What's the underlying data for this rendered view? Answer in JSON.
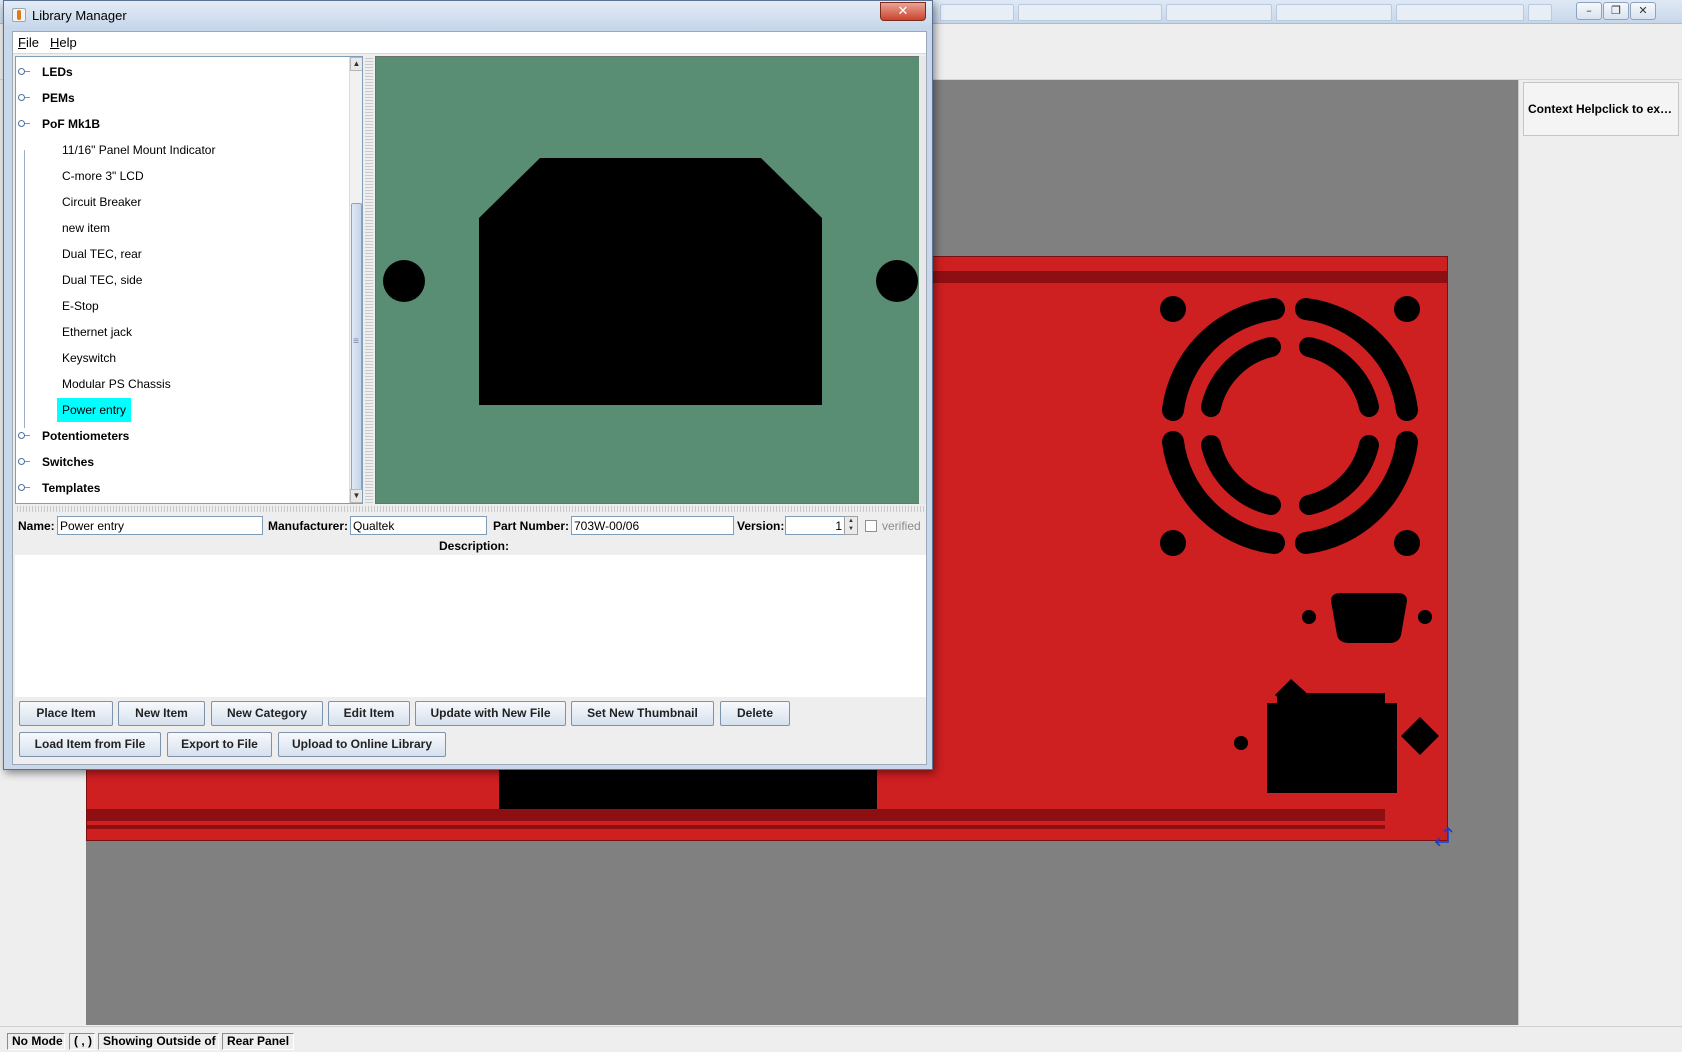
{
  "dialog": {
    "title": "Library Manager",
    "close_glyph": "✕",
    "menu": [
      "File",
      "Help"
    ]
  },
  "tree": {
    "categories_top": [
      "LEDs",
      "PEMs",
      "PoF Mk1B"
    ],
    "items": [
      "11/16\" Panel Mount Indicator",
      "C-more 3\" LCD",
      "Circuit Breaker",
      "new item",
      "Dual TEC, rear",
      "Dual TEC, side",
      "E-Stop",
      "Ethernet jack",
      "Keyswitch",
      "Modular PS Chassis",
      "Power entry"
    ],
    "selected_item": "Power entry",
    "categories_bottom": [
      "Potentiometers",
      "Switches",
      "Templates"
    ]
  },
  "fields": {
    "name_label": "Name:",
    "name_value": "Power entry",
    "manufacturer_label": "Manufacturer:",
    "manufacturer_value": "Qualtek",
    "part_number_label": "Part Number:",
    "part_number_value": "703W-00/06",
    "version_label": "Version:",
    "version_value": "1",
    "verified_label": "verified",
    "description_label": "Description:",
    "description_value": ""
  },
  "buttons_row1": [
    "Place Item",
    "New Item",
    "New Category",
    "Edit Item",
    "Update with New File",
    "Set New Thumbnail",
    "Delete"
  ],
  "buttons_row2": [
    "Load Item from File",
    "Export to File",
    "Upload to Online Library"
  ],
  "context_help": "Context Helpclick to expa...",
  "status": [
    "No Mode",
    "( , )",
    "Showing Outside of",
    "Rear Panel"
  ],
  "colors": {
    "panel_red": "#ce1f21",
    "preview_green": "#5a8e74",
    "selection_cyan": "#00ffff",
    "canvas_gray": "#808080"
  },
  "icons": {
    "main_controls": [
      "minimize-icon",
      "restore-icon",
      "close-icon"
    ],
    "resize": "resize-corner-icon"
  }
}
